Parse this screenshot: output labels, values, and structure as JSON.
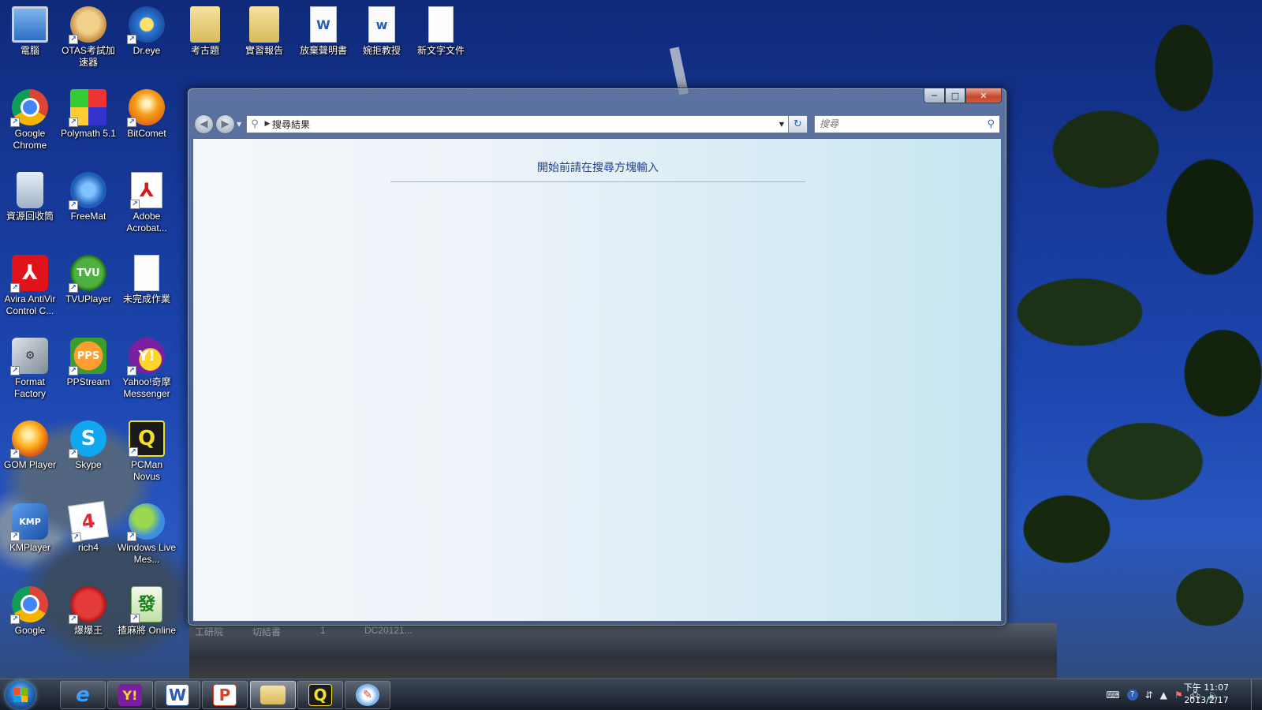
{
  "desktop": {
    "icons": [
      {
        "label": "電腦",
        "icon": "computer-icon"
      },
      {
        "label": "OTAS考試加速器",
        "icon": "otas-icon"
      },
      {
        "label": "Dr.eye",
        "icon": "dreye-icon"
      },
      {
        "label": "考古題",
        "icon": "folder-icon"
      },
      {
        "label": "實習報告",
        "icon": "folder-icon"
      },
      {
        "label": "放棄聲明書",
        "icon": "word-document-icon"
      },
      {
        "label": "婉拒教授",
        "icon": "word-document-icon"
      },
      {
        "label": "新文字文件",
        "icon": "text-document-icon"
      },
      {
        "label": "Google Chrome",
        "icon": "chrome-icon"
      },
      {
        "label": "Polymath 5.1",
        "icon": "polymath-icon"
      },
      {
        "label": "BitComet",
        "icon": "bitcomet-icon"
      },
      {
        "label": "資源回收筒",
        "icon": "recycle-bin-icon"
      },
      {
        "label": "FreeMat",
        "icon": "freemat-icon"
      },
      {
        "label": "Adobe Acrobat...",
        "icon": "pdf-icon"
      },
      {
        "label": "Avira AntiVir Control C...",
        "icon": "avira-icon"
      },
      {
        "label": "TVUPlayer",
        "icon": "tvu-icon"
      },
      {
        "label": "未完成作業",
        "icon": "text-document-icon"
      },
      {
        "label": "Format Factory",
        "icon": "format-factory-icon"
      },
      {
        "label": "PPStream",
        "icon": "ppstream-icon"
      },
      {
        "label": "Yahoo!奇摩 Messenger",
        "icon": "yahoo-messenger-icon"
      },
      {
        "label": "GOM Player",
        "icon": "gom-player-icon"
      },
      {
        "label": "Skype",
        "icon": "skype-icon"
      },
      {
        "label": "PCMan Novus",
        "icon": "pcman-icon"
      },
      {
        "label": "KMPlayer",
        "icon": "kmplayer-icon"
      },
      {
        "label": "rich4",
        "icon": "rich4-icon"
      },
      {
        "label": "Windows Live Mes...",
        "icon": "live-messenger-icon"
      },
      {
        "label": "Google",
        "icon": "chrome-icon"
      },
      {
        "label": "爆爆王",
        "icon": "bnb-icon"
      },
      {
        "label": "揸麻將 Online",
        "icon": "mahjong-icon"
      }
    ],
    "ghost_labels": [
      "工研院",
      "切結書",
      "1",
      "DC20121..."
    ]
  },
  "window": {
    "controls": {
      "minimize": "─",
      "maximize": "□",
      "close": "✕"
    },
    "address": {
      "path": "搜尋結果"
    },
    "search": {
      "placeholder": "搜尋"
    },
    "content": {
      "hint": "開始前請在搜尋方塊輸入"
    }
  },
  "taskbar": {
    "pinned": [
      "internet-explorer",
      "yahoo-messenger",
      "word",
      "powerpoint-like",
      "explorer",
      "pcman",
      "paint"
    ],
    "active": "explorer",
    "clock": {
      "time": "下午 11:07",
      "date": "2013/2/17"
    }
  },
  "colors": {
    "accent": "#1e3f8a",
    "close": "#c64527"
  }
}
